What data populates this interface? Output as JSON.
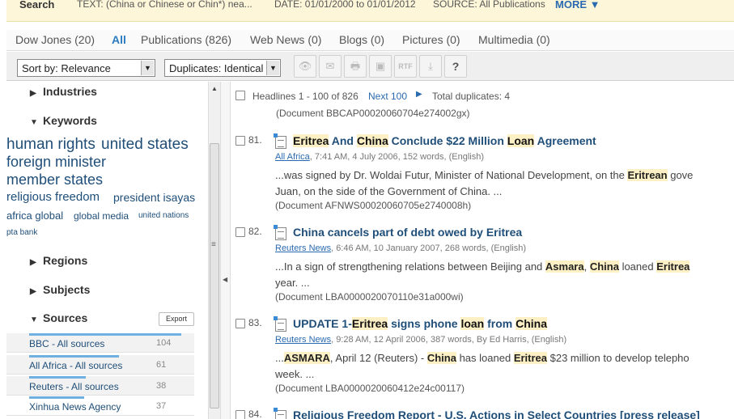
{
  "search_bar": {
    "search_label": "Search",
    "text_query": "TEXT: (China or Chinese or Chin*) nea...",
    "date_range": "DATE: 01/01/2000 to 01/01/2012",
    "source": "SOURCE: All Publications",
    "more_label": "MORE ▼"
  },
  "tabs": [
    {
      "label": "Dow Jones  (20)"
    },
    {
      "label": "All"
    },
    {
      "label": "Publications  (826)"
    },
    {
      "label": "Web News  (0)"
    },
    {
      "label": "Blogs  (0)"
    },
    {
      "label": "Pictures  (0)"
    },
    {
      "label": "Multimedia  (0)"
    }
  ],
  "toolbar": {
    "sort_value": "Sort by: Relevance",
    "duplicates_value": "Duplicates: Identical",
    "rtf_label": "RTF",
    "help_label": "?"
  },
  "left_panel": {
    "sections": {
      "industries": "Industries",
      "keywords": "Keywords",
      "regions": "Regions",
      "subjects": "Subjects",
      "sources": "Sources"
    },
    "keywords": [
      "human rights",
      "united states",
      "foreign minister",
      "member states",
      "religious freedom",
      "president isayas",
      "africa global",
      "global media",
      "united nations",
      "pta bank"
    ],
    "export_label": "Export",
    "sources": [
      {
        "name": "BBC - All sources",
        "count": "104",
        "bar_fraction": 1.0
      },
      {
        "name": "All Africa - All sources",
        "count": "61",
        "bar_fraction": 0.59
      },
      {
        "name": "Reuters - All sources",
        "count": "38",
        "bar_fraction": 0.37
      },
      {
        "name": "Xinhua News Agency",
        "count": "37",
        "bar_fraction": 0.36
      }
    ]
  },
  "results": {
    "headlines_label": "Headlines 1 - 100 of 826",
    "next_label": "Next 100",
    "total_duplicates": "Total duplicates: 4",
    "prev_doc_id": "(Document BBCAP00020060704e274002gx)",
    "items": [
      {
        "num": "81.",
        "title_parts": [
          "Eritrea",
          " And ",
          "China",
          " Conclude $22 Million ",
          "Loan",
          " Agreement"
        ],
        "source": "All Africa",
        "meta": ", 7:41 AM, 4 July 2006, 152 words, (English)",
        "snip1_parts": [
          "...was signed by Dr. Woldai Futur, Minister of National Development, on the ",
          "Eritrean",
          " gove"
        ],
        "snip2": "Juan, on the side of the Government of China. ...",
        "doc_id": "(Document AFNWS00020060705e2740008h)"
      },
      {
        "num": "82.",
        "title": "China cancels part of debt owed by Eritrea",
        "source": "Reuters News",
        "meta": ", 6:46 AM, 10 January 2007, 268 words, (English)",
        "snip1_parts": [
          "...In a sign of strengthening relations between Beijing and ",
          "Asmara",
          ", ",
          "China",
          " loaned ",
          "Eritrea"
        ],
        "snip2": "year. ...",
        "doc_id": "(Document LBA0000020070110e31a000wi)"
      },
      {
        "num": "83.",
        "title_parts": [
          "UPDATE 1-",
          "Eritrea",
          " signs phone ",
          "loan",
          " from ",
          "China"
        ],
        "source": "Reuters News",
        "meta": ", 9:28 AM, 12 April 2006, 387 words, By Ed Harris, (English)",
        "snip1_parts": [
          "...",
          "ASMARA",
          ", April 12 (Reuters) - ",
          "China",
          " has loaned ",
          "Eritrea",
          " $23 million to develop telepho"
        ],
        "snip2": "week. ...",
        "doc_id": "(Document LBA0000020060412e24c00117)"
      },
      {
        "num": "84.",
        "title": "Religious Freedom Report - U.S. Actions in Select Countries [press release]"
      }
    ]
  }
}
